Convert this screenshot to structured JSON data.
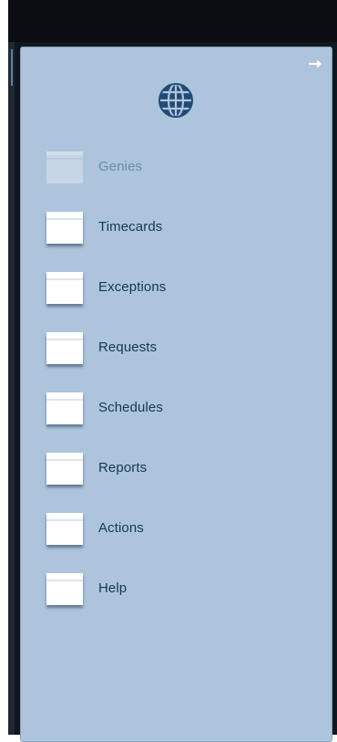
{
  "nav": {
    "items": [
      {
        "label": "Genies",
        "state": "disabled"
      },
      {
        "label": "Timecards",
        "state": "enabled"
      },
      {
        "label": "Exceptions",
        "state": "enabled"
      },
      {
        "label": "Requests",
        "state": "enabled"
      },
      {
        "label": "Schedules",
        "state": "enabled"
      },
      {
        "label": "Reports",
        "state": "enabled"
      },
      {
        "label": "Actions",
        "state": "enabled"
      },
      {
        "label": "Help",
        "state": "enabled"
      }
    ]
  },
  "icons": {
    "expand": "arrow-right-icon",
    "home": "globe-icon",
    "nav_item": "window-icon"
  },
  "colors": {
    "panel_background": "#adc5dc",
    "label_text": "#1b3554",
    "disabled_label_text": "#6f89a6",
    "top_bar": "#0b0d12"
  }
}
